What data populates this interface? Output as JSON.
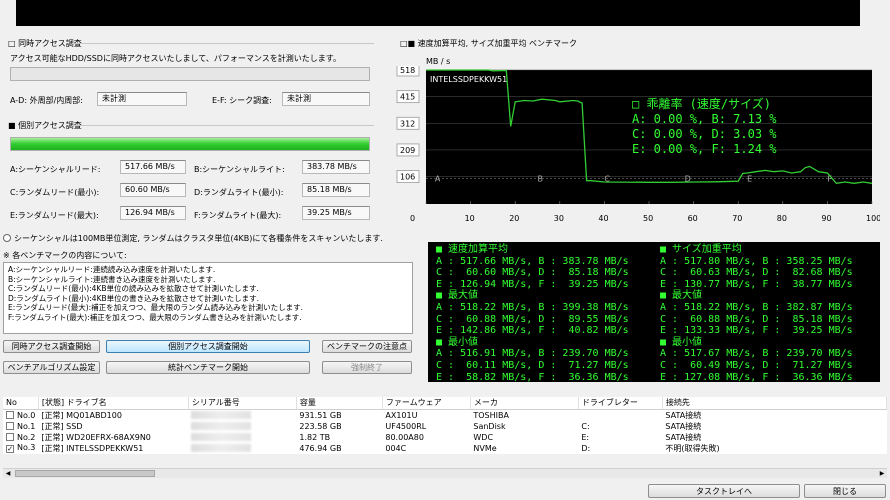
{
  "simultaneous": {
    "title": "□ 同時アクセス調査",
    "description": "アクセス可能なHDD/SSDに同時アクセスいたしまして、パフォーマンスを計測いたします。",
    "ad_label": "A-D: 外周部/内周部:",
    "ad_value": "未計測",
    "ef_label": "E-F: シーク調査:",
    "ef_value": "未計測"
  },
  "individual": {
    "title": "■ 個別アクセス調査",
    "progress_percent": 100,
    "rows": [
      {
        "l1": "A:シーケンシャルリード:",
        "v1": "517.66 MB/s",
        "l2": "B:シーケンシャルライト:",
        "v2": "383.78 MB/s"
      },
      {
        "l1": "C:ランダムリード(最小):",
        "v1": "60.60 MB/s",
        "l2": "D:ランダムライト(最小):",
        "v2": "85.18 MB/s"
      },
      {
        "l1": "E:ランダムリード(最大):",
        "v1": "126.94 MB/s",
        "l2": "F:ランダムライト(最大):",
        "v2": "39.25 MB/s"
      }
    ]
  },
  "option": {
    "radio_label": "シーケンシャルは100MB単位測定, ランダムはクラスタ単位(4KB)にて各種条件をスキャンいたします."
  },
  "benchmark_desc": {
    "title": "※ 各ベンチマークの内容について:",
    "lines": [
      "A:シーケンシャルリード:連続読み込み速度を計測いたします.",
      "B:シーケンシャルライト:連続書き込み速度を計測いたします.",
      "C:ランダムリード(最小):4KB単位の読み込みを拡散させて計測いたします.",
      "D:ランダムライト(最小):4KB単位の書き込みを拡散させて計測いたします.",
      "E:ランダムリード(最大):補正を加えつつ、最大限のランダム読み込みを計測いたします.",
      "F:ランダムライト(最大):補正を加えつつ、最大限のランダム書き込みを計測いたします."
    ]
  },
  "buttons": {
    "simultaneous_start": "同時アクセス調査開始",
    "individual_start": "個別アクセス調査開始",
    "notes": "ベンチマークの注意点",
    "algorithm": "ベンチアルゴリズム設定",
    "stats_start": "統計ベンチマーク開始",
    "force_stop": "強制終了",
    "tray": "タスクトレイへ",
    "close": "閉じる"
  },
  "chart_data": {
    "type": "line",
    "title": "□■ 速度加算平均, サイズ加重平均 ベンチマーク",
    "ylabel": "MB / s",
    "drive_label": "INTELSSDPEKKW51",
    "xlim": [
      0,
      100
    ],
    "ylim": [
      0,
      518
    ],
    "y_ticks": [
      106,
      209,
      312,
      415,
      518
    ],
    "x_ticks": [
      0,
      10,
      20,
      30,
      40,
      50,
      60,
      70,
      80,
      90,
      100
    ],
    "phase_letters": [
      {
        "letter": "A",
        "x": 2
      },
      {
        "letter": "B",
        "x": 25
      },
      {
        "letter": "C",
        "x": 40
      },
      {
        "letter": "D",
        "x": 58
      },
      {
        "letter": "E",
        "x": 72
      },
      {
        "letter": "F",
        "x": 90
      }
    ],
    "series": [
      {
        "color": "#33cc33",
        "x": [
          0,
          14,
          15,
          18,
          19,
          20,
          22,
          24,
          26,
          29,
          30,
          33,
          34,
          35,
          36,
          37,
          40,
          50,
          55,
          60,
          65,
          70,
          71,
          72,
          74,
          76,
          78,
          80,
          82,
          84,
          85,
          86,
          87,
          88,
          90,
          92,
          94,
          96,
          98,
          100
        ],
        "y": [
          518,
          518,
          515,
          516,
          300,
          395,
          400,
          398,
          405,
          400,
          395,
          400,
          398,
          390,
          90,
          90,
          85,
          84,
          84,
          85,
          86,
          88,
          118,
          120,
          125,
          130,
          125,
          128,
          120,
          125,
          140,
          145,
          135,
          125,
          120,
          80,
          85,
          80,
          85,
          80
        ]
      }
    ],
    "stat_box": {
      "title": "□ 乖離率 (速度/サイズ)",
      "lines": [
        "A:  0.00 %, B:  7.13 %",
        "C:  0.00 %, D:  3.03 %",
        "E:  0.00 %, F:  1.24 %"
      ]
    }
  },
  "readout": {
    "left": [
      "■ 速度加算平均",
      "A : 517.66 MB/s, B : 383.78 MB/s",
      "C :  60.60 MB/s, D :  85.18 MB/s",
      "E : 126.94 MB/s, F :  39.25 MB/s",
      "■ 最大値",
      "A : 518.22 MB/s, B : 399.38 MB/s",
      "C :  60.88 MB/s, D :  89.55 MB/s",
      "E : 142.86 MB/s, F :  40.82 MB/s",
      "■ 最小値",
      "A : 516.91 MB/s, B : 239.70 MB/s",
      "C :  60.11 MB/s, D :  71.27 MB/s",
      "E :  58.82 MB/s, F :  36.36 MB/s"
    ],
    "right": [
      "■ サイズ加重平均",
      "A : 517.80 MB/s, B : 358.25 MB/s",
      "C :  60.63 MB/s, D :  82.68 MB/s",
      "E : 130.77 MB/s, F :  38.77 MB/s",
      "■ 最大値",
      "A : 518.22 MB/s, B : 382.87 MB/s",
      "C :  60.88 MB/s, D :  85.18 MB/s",
      "E : 133.33 MB/s, F :  39.25 MB/s",
      "■ 最小値",
      "A : 517.67 MB/s, B : 239.70 MB/s",
      "C :  60.49 MB/s, D :  71.27 MB/s",
      "E : 127.08 MB/s, F :  36.36 MB/s"
    ]
  },
  "drive_table": {
    "columns": [
      "No",
      "[状態] ドライブ名",
      "シリアル番号",
      "容量",
      "ファームウェア",
      "メーカ",
      "ドライブレター",
      "接続先"
    ],
    "rows": [
      {
        "no": "No.0",
        "checked": false,
        "name": "[正常] MQ01ABD100",
        "capacity": "931.51 GB",
        "firmware": "AX101U",
        "maker": "TOSHIBA",
        "letter": "",
        "connection": "SATA接続"
      },
      {
        "no": "No.1",
        "checked": false,
        "name": "[正常] SSD",
        "capacity": "223.58 GB",
        "firmware": "UF4500RL",
        "maker": "SanDisk",
        "letter": "C:",
        "connection": "SATA接続"
      },
      {
        "no": "No.2",
        "checked": false,
        "name": "[正常] WD20EFRX-68AX9N0",
        "capacity": "1.82 TB",
        "firmware": "80.00A80",
        "maker": "WDC",
        "letter": "E:",
        "connection": "SATA接続"
      },
      {
        "no": "No.3",
        "checked": true,
        "name": "[正常] INTELSSDPEKKW51",
        "capacity": "476.94 GB",
        "firmware": "004C",
        "maker": "NVMe",
        "letter": "D:",
        "connection": "不明(取得失敗)"
      }
    ]
  }
}
